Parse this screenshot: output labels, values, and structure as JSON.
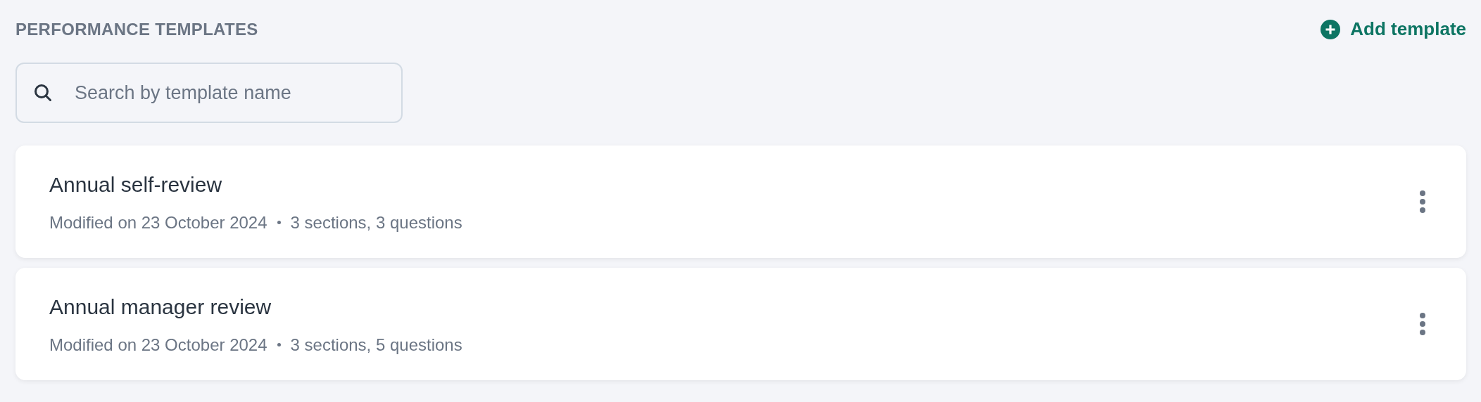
{
  "header": {
    "title": "PERFORMANCE TEMPLATES",
    "add_button": "Add template"
  },
  "search": {
    "placeholder": "Search by template name"
  },
  "templates": [
    {
      "name": "Annual self-review",
      "modified": "Modified on 23 October 2024",
      "summary": "3 sections, 3 questions"
    },
    {
      "name": "Annual manager review",
      "modified": "Modified on 23 October 2024",
      "summary": "3 sections, 5 questions"
    }
  ]
}
